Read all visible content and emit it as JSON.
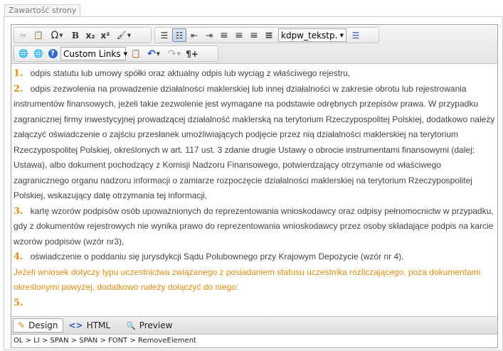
{
  "section_tab": {
    "label": "Zawartość strony"
  },
  "toolbar": {
    "row1": {
      "cut_glyph": "✂",
      "paste_glyph": "📋",
      "symbols_glyph": "Ω",
      "bold_glyph": "B",
      "subscript_glyph": "x₂",
      "superscript_glyph": "x²",
      "format_glyph": "🖌",
      "bullets_glyph": "☰",
      "numbered_glyph": "☷",
      "outdent_glyph": "⇤",
      "indent_glyph": "⇥",
      "align_left_glyph": "≡",
      "align_center_glyph": "≡",
      "align_right_glyph": "≡",
      "justify_glyph": "≡",
      "css_class_value": "kdpw_tekstp...",
      "paragraph_style_glyph": "☰"
    },
    "row2": {
      "link_manager_glyph": "🌐",
      "remove_link_glyph": "🌐",
      "help_glyph": "?",
      "custom_links_label": "Custom Links",
      "paste_options_glyph": "📋",
      "undo_glyph": "↶",
      "redo_glyph": "↷",
      "paragraph_glyph": "¶+"
    }
  },
  "content": {
    "items": [
      {
        "number": "1.",
        "text": "odpis statutu lub umowy spółki oraz aktualny odpis lub wyciąg z właściwego rejestru,"
      },
      {
        "number": "2.",
        "text": "odpis zezwolenia na prowadzenie działalności maklerskiej lub innej działalności w zakresie obrotu lub rejestrowania instrumentów finansowych, jeżeli takie zezwolenie jest wymagane na podstawie odrębnych przepisów prawa. W przypadku zagranicznej firmy inwestycyjnej prowadzącej działalność maklerską na terytorium Rzeczypospolitej Polskiej, dodatkowo należy załączyć oświadczenie o zajściu przesłanek umożliwiających podjęcie przez nią działalności maklerskiej na terytorium Rzeczypospolitej Polskiej, określonych w art. 117 ust. 3 zdanie drugie Ustawy o obrocie instrumentami finansowymi (dalej: Ustawa), albo dokument pochodzący z Komisji Nadzoru Finansowego, potwierdzający otrzymanie od właściwego zagranicznego organu nadzoru informacji o zamiarze rozpoczęcie działalności maklerskiej na terytorium Rzeczypospolitej Polskiej, wskazujący datę otrzymania tej informacji,"
      },
      {
        "number": "3.",
        "text": "kartę wzorów podpisów osób upoważnionych do reprezentowania wnioskodawcy oraz odpisy pełnomocnictw w przypadku, gdy z dokumentów rejestrowych nie wynika prawo do reprezentowania wnioskodawcy przez osoby składające podpis na karcie wzorów podpisów (wzór nr3),"
      },
      {
        "number": "4.",
        "text": "oświadczenie o poddaniu się jurysdykcji Sądu Polubownego przy Krajowym Depozycie (wzór nr 4)."
      }
    ],
    "note": "Jeżeli wniosek dotyczy typu uczestnictwa związanego z posiadaniem statusu uczestnika rozliczającego, poza dokumentami określonymi powyżej, dodatkowo należy dołączyć do niego:",
    "empty_item_number": "5."
  },
  "modes": {
    "design": {
      "label": "Design",
      "glyph": "✎"
    },
    "html": {
      "label": "HTML",
      "glyph": "<>"
    },
    "preview": {
      "label": "Preview",
      "glyph": "🔍"
    }
  },
  "status_path": "OL > LI > SPAN > SPAN > FONT > RemoveElement",
  "colors": {
    "accent_orange": "#e38d13",
    "text_gray": "#444444"
  }
}
